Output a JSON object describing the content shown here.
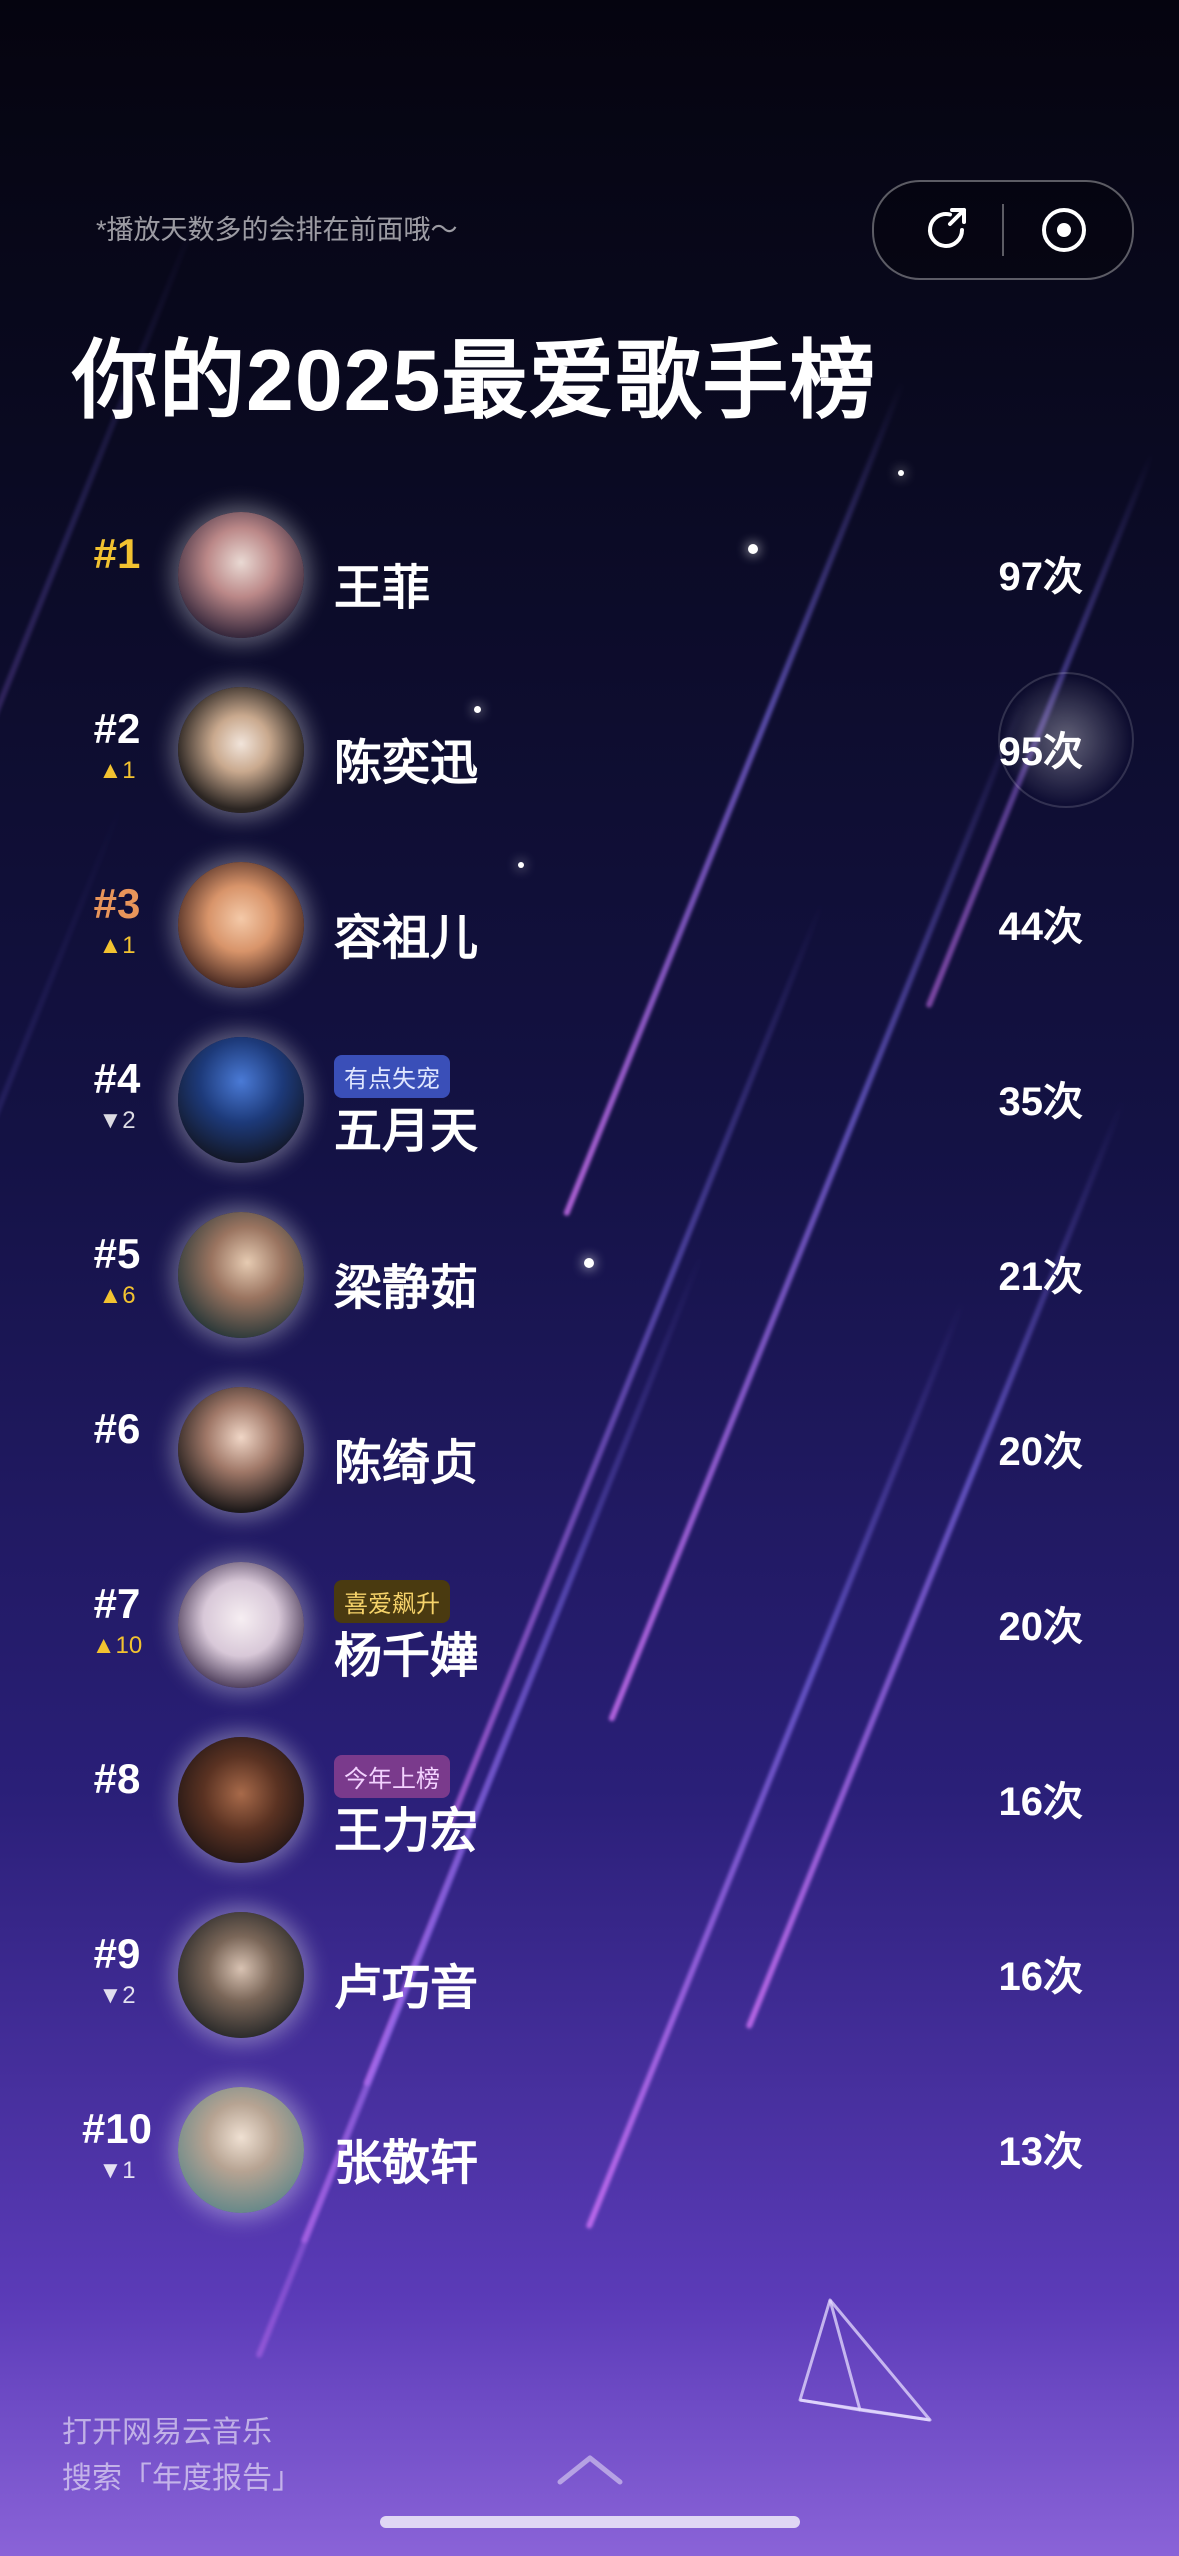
{
  "hint": "*播放天数多的会排在前面哦～",
  "title": "你的2025最爱歌手榜",
  "controls": {
    "share_icon": "share-icon",
    "record_icon": "record-icon"
  },
  "artists": [
    {
      "rank": "#1",
      "change": "",
      "name": "王菲",
      "tag": "",
      "count": "97次"
    },
    {
      "rank": "#2",
      "change": "▲1",
      "name": "陈奕迅",
      "tag": "",
      "count": "95次"
    },
    {
      "rank": "#3",
      "change": "▲1",
      "name": "容祖儿",
      "tag": "",
      "count": "44次"
    },
    {
      "rank": "#4",
      "change": "▼2",
      "name": "五月天",
      "tag": "有点失宠",
      "count": "35次"
    },
    {
      "rank": "#5",
      "change": "▲6",
      "name": "梁静茹",
      "tag": "",
      "count": "21次"
    },
    {
      "rank": "#6",
      "change": "",
      "name": "陈绮贞",
      "tag": "",
      "count": "20次"
    },
    {
      "rank": "#7",
      "change": "▲10",
      "name": "杨千嬅",
      "tag": "喜爱飙升",
      "count": "20次"
    },
    {
      "rank": "#8",
      "change": "",
      "name": "王力宏",
      "tag": "今年上榜",
      "count": "16次"
    },
    {
      "rank": "#9",
      "change": "▼2",
      "name": "卢巧音",
      "tag": "",
      "count": "16次"
    },
    {
      "rank": "#10",
      "change": "▼1",
      "name": "张敬轩",
      "tag": "",
      "count": "13次"
    }
  ],
  "footer": {
    "line1": "打开网易云音乐",
    "line2": "搜索「年度报告」"
  },
  "colors": {
    "gold": "#f2c230",
    "bronze": "#e8955a",
    "tag_blue": "#3a4fb8",
    "tag_gold": "#4a3a10",
    "tag_pink": "#7a3a8c"
  }
}
